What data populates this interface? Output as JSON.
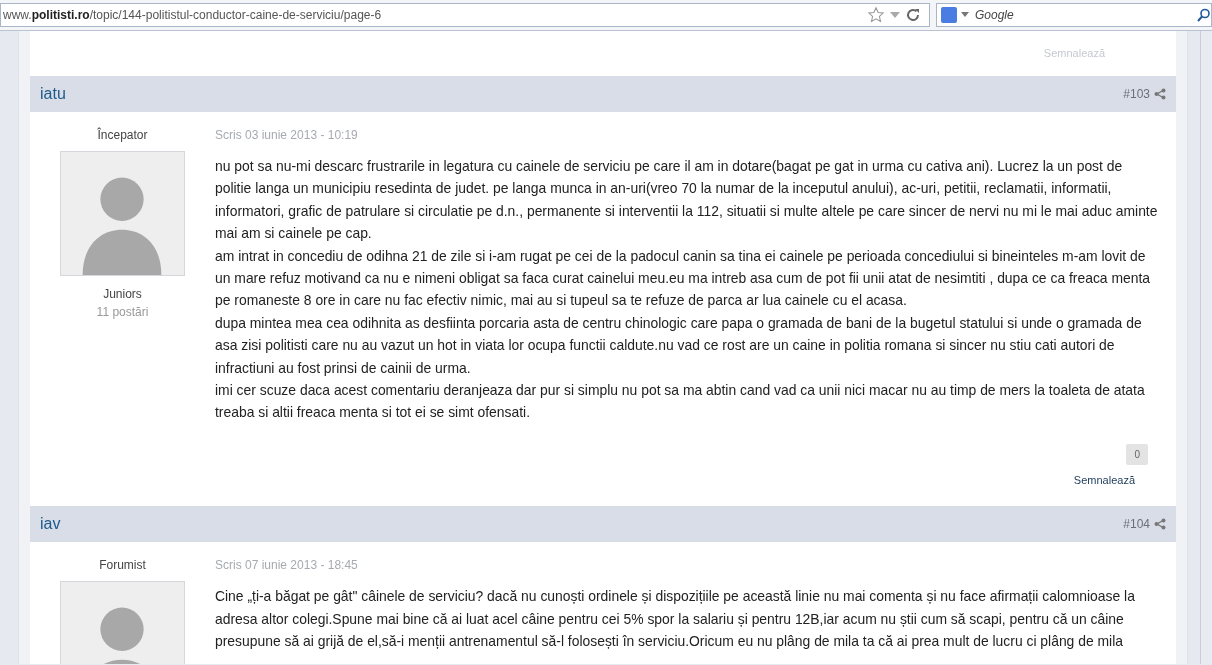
{
  "browser": {
    "url": "www.**politisti.ro**/topic/144-politistul-conductor-caine-de-serviciu/page-6",
    "search_placeholder": "Google"
  },
  "previous_post": {
    "report": "Semnalează"
  },
  "posts": [
    {
      "author": "iatu",
      "number": "#103",
      "rank": "Începator",
      "group": "Juniors",
      "post_count": "11 postări",
      "date": "Scris 03 iunie 2013 - 10:19",
      "paragraphs": [
        "nu pot sa nu-mi  descarc frustrarile in legatura cu cainele de serviciu pe care il am in dotare(bagat pe gat in urma cu cativa ani). Lucrez la un post de politie langa un municipiu resedinta de judet. pe langa munca in an-uri(vreo 70 la numar de la inceputul anului), ac-uri, petitii, reclamatii, informatii, informatori, grafic de patrulare si circulatie pe d.n., permanente si interventii la 112, situatii si multe altele pe  care sincer de nervi nu mi le mai aduc aminte mai am si cainele pe cap.",
        "am intrat in concediu de odihna 21 de zile si i-am rugat pe cei de la padocul canin sa tina ei cainele pe perioada concediului si bineinteles m-am lovit de un mare refuz motivand ca nu e nimeni obligat sa faca curat cainelui meu.eu ma intreb asa cum de pot fii unii atat de nesimtiti , dupa ce ca freaca menta pe romaneste 8 ore in care nu fac efectiv nimic, mai au si tupeul sa te refuze de parca ar lua cainele cu el acasa.",
        "dupa mintea mea cea odihnita as desfiinta porcaria asta de centru chinologic care papa o gramada de bani de la bugetul statului si unde o gramada de asa zisi politisti care nu au vazut un hot in viata lor ocupa functii caldute.nu vad ce rost are un caine in politia romana si sincer nu stiu cati autori de infractiuni au fost prinsi de cainii de urma.",
        "imi cer scuze daca acest comentariu deranjeaza dar pur si simplu nu pot sa ma abtin cand vad ca unii nici macar nu au timp de mers la toaleta de atata treaba si altii freaca menta si tot ei se simt ofensati."
      ],
      "reputation": "0",
      "report": "Semnalează"
    },
    {
      "author": "iav",
      "number": "#104",
      "rank": "Forumist",
      "date": "Scris 07 iunie 2013 - 18:45",
      "paragraphs": [
        "Cine „ți-a băgat pe gât\" câinele de serviciu? dacă nu cunoști ordinele și dispozițiile pe această linie nu mai comenta și nu face afirmații calomnioase la adresa altor colegi.Spune mai bine că ai luat acel câine pentru cei 5% spor la salariu și pentru 12B,iar acum nu știi cum să scapi, pentru că un câine presupune să ai grijă de el,să-i menții antrenamentul să-l folosești în serviciu.Oricum eu nu plâng de mila ta că ai prea mult de lucru ci plâng de mila"
      ]
    }
  ]
}
